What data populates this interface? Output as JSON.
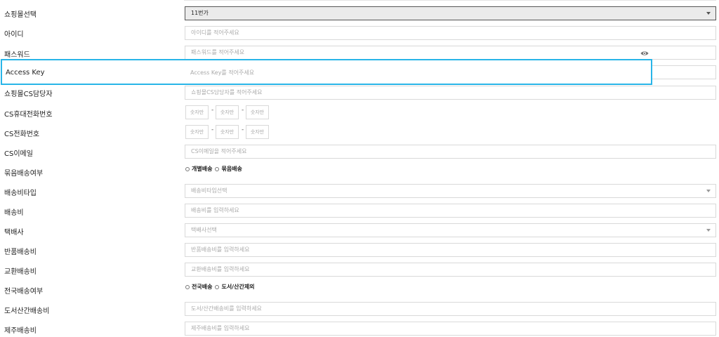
{
  "fields": {
    "mall": {
      "label": "쇼핑몰선택",
      "value": "11번가"
    },
    "id": {
      "label": "아이디",
      "placeholder": "아이디를 적어주세요"
    },
    "password": {
      "label": "패스워드",
      "placeholder": "패스워드를 적어주세요",
      "icon": "eye-icon"
    },
    "access_key": {
      "label": "Access Key",
      "placeholder": "Access Key를 적어주세요"
    },
    "cs_manager": {
      "label": "쇼핑몰CS담당자",
      "placeholder": "쇼핑몰CS담당자를 적어주세요"
    },
    "cs_mobile": {
      "label": "CS휴대전화번호",
      "placeholders": [
        "숫자만",
        "숫자만",
        "숫자만"
      ],
      "sep": "-"
    },
    "cs_phone": {
      "label": "CS전화번호",
      "placeholders": [
        "숫자만",
        "숫자만",
        "숫자만"
      ],
      "sep": "-"
    },
    "cs_email": {
      "label": "CS이메일",
      "placeholder": "CS이메일을 적어주세요"
    },
    "bundle_shipping": {
      "label": "묶음배송여부",
      "options": [
        "개별배송",
        "묶음배송"
      ]
    },
    "shipping_type": {
      "label": "배송비타입",
      "placeholder": "배송비타입선택"
    },
    "shipping_fee": {
      "label": "배송비",
      "placeholder": "배송비를 입력하세요"
    },
    "courier": {
      "label": "택배사",
      "placeholder": "택배사선택"
    },
    "return_fee": {
      "label": "반품배송비",
      "placeholder": "반품배송비를 입력하세요"
    },
    "exchange_fee": {
      "label": "교환배송비",
      "placeholder": "교환배송비를 입력하세요"
    },
    "nationwide_shipping": {
      "label": "전국배송여부",
      "options": [
        "전국배송",
        "도서/산간제외"
      ]
    },
    "island_fee": {
      "label": "도서산간배송비",
      "placeholder": "도서/산간배송비를 입력하세요"
    },
    "jeju_fee": {
      "label": "제주배송비",
      "placeholder": "제주배송비를 입력하세요"
    }
  },
  "colors": {
    "highlight": "#29b5e8",
    "border": "#d9d9d9",
    "placeholder": "#aaaaaa"
  }
}
